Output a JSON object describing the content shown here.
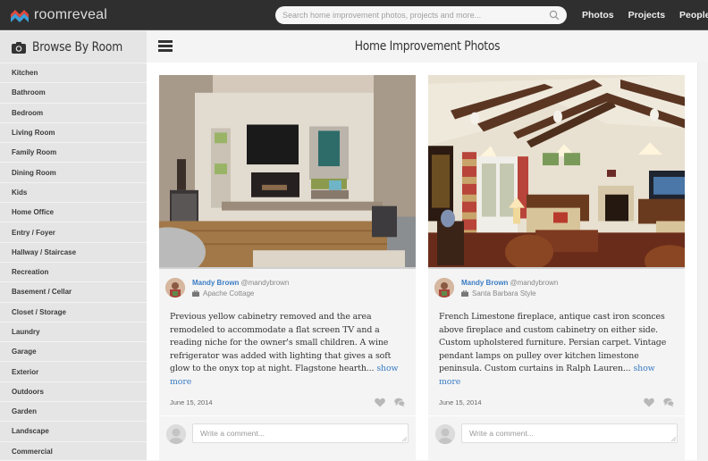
{
  "topbar": {
    "logo_text": "roomreveal",
    "search_placeholder": "Search home improvement photos, projects and more...",
    "nav": [
      "Photos",
      "Projects",
      "People"
    ],
    "brand_colors": {
      "red": "#e0483e",
      "blue": "#3b9fd8"
    }
  },
  "sidebar": {
    "title": "Browse By Room",
    "title_icon": "camera-icon",
    "items": [
      "Kitchen",
      "Bathroom",
      "Bedroom",
      "Living Room",
      "Family Room",
      "Dining Room",
      "Kids",
      "Home Office",
      "Entry / Foyer",
      "Hallway / Staircase",
      "Recreation",
      "Basement / Cellar",
      "Closet / Storage",
      "Laundry",
      "Garage",
      "Exterior",
      "Outdoors",
      "Garden",
      "Landscape",
      "Commercial"
    ]
  },
  "main": {
    "menu_icon": "hamburger-icon",
    "title": "Home Improvement Photos",
    "cards": [
      {
        "photo_alt": "Living room with built-in TV, fireplace and reading niche",
        "author_name": "Mandy Brown",
        "author_handle": "@mandybrown",
        "project": "Apache Cottage",
        "description": "Previous yellow cabinetry removed and the area remodeled to accommodate a flat screen TV and a reading niche for the owner's small children. A wine refrigerator was added with lighting that gives a soft glow to the onyx top at night. Flagstone hearth...",
        "show_more": "show more",
        "date": "June 15, 2014",
        "comment_placeholder": "Write a comment..."
      },
      {
        "photo_alt": "Great room with exposed beams, pendant lamps and limestone fireplace",
        "author_name": "Mandy Brown",
        "author_handle": "@mandybrown",
        "project": "Santa Barbara Style",
        "description": "French Limestone fireplace, antique cast iron sconces above fireplace and custom cabinetry on either side. Custom upholstered furniture. Persian carpet. Vintage pendant lamps on pulley over kitchen limestone peninsula. Custom curtains in Ralph Lauren...",
        "show_more": "show more",
        "date": "June 15, 2014",
        "comment_placeholder": "Write a comment..."
      }
    ],
    "link_color": "#3b7dc4"
  }
}
